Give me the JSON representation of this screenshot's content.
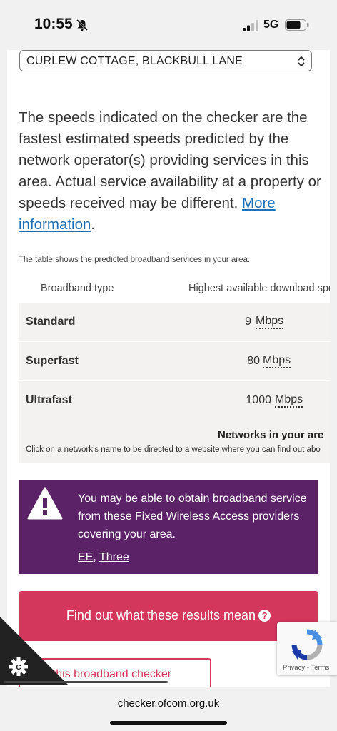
{
  "status_bar": {
    "time": "10:55",
    "network": "5G"
  },
  "address": {
    "selected": "CURLEW COTTAGE, BLACKBULL LANE"
  },
  "disclaimer": {
    "text": "The speeds indicated on the checker are the fastest estimated speeds predicted by the network operator(s) providing services in this area. Actual service availability at a property or speeds received may be different. ",
    "link": "More information",
    "end": "."
  },
  "table": {
    "caption": "The table shows the predicted broadband services in your area.",
    "headers": [
      "Broadband type",
      "Highest available download spe"
    ],
    "rows": [
      {
        "type": "Standard",
        "speed": "9",
        "unit": "Mbps"
      },
      {
        "type": "Superfast",
        "speed": "80",
        "unit": "Mbps"
      },
      {
        "type": "Ultrafast",
        "speed": "1000",
        "unit": "Mbps"
      }
    ],
    "networks_heading": "Networks in your are",
    "networks_note": "Click on a network’s name to be directed to a website where you can find out abo"
  },
  "alert": {
    "text": "You may be able to obtain broadband service from these Fixed Wireless Access providers covering your area.",
    "providers": [
      "EE",
      "Three"
    ],
    "separator": ", "
  },
  "cta": {
    "label": "Find out what these results mean"
  },
  "secondary_button": {
    "label": "ut this broadband checker"
  },
  "recaptcha": {
    "privacy": "Privacy",
    "dash": " - ",
    "terms": "Terms"
  },
  "url_bar": {
    "url": "checker.ofcom.org.uk"
  },
  "colors": {
    "alert_purple": "#5c2268",
    "cta_pink": "#d4375c",
    "link_blue": "#1d70b8"
  }
}
